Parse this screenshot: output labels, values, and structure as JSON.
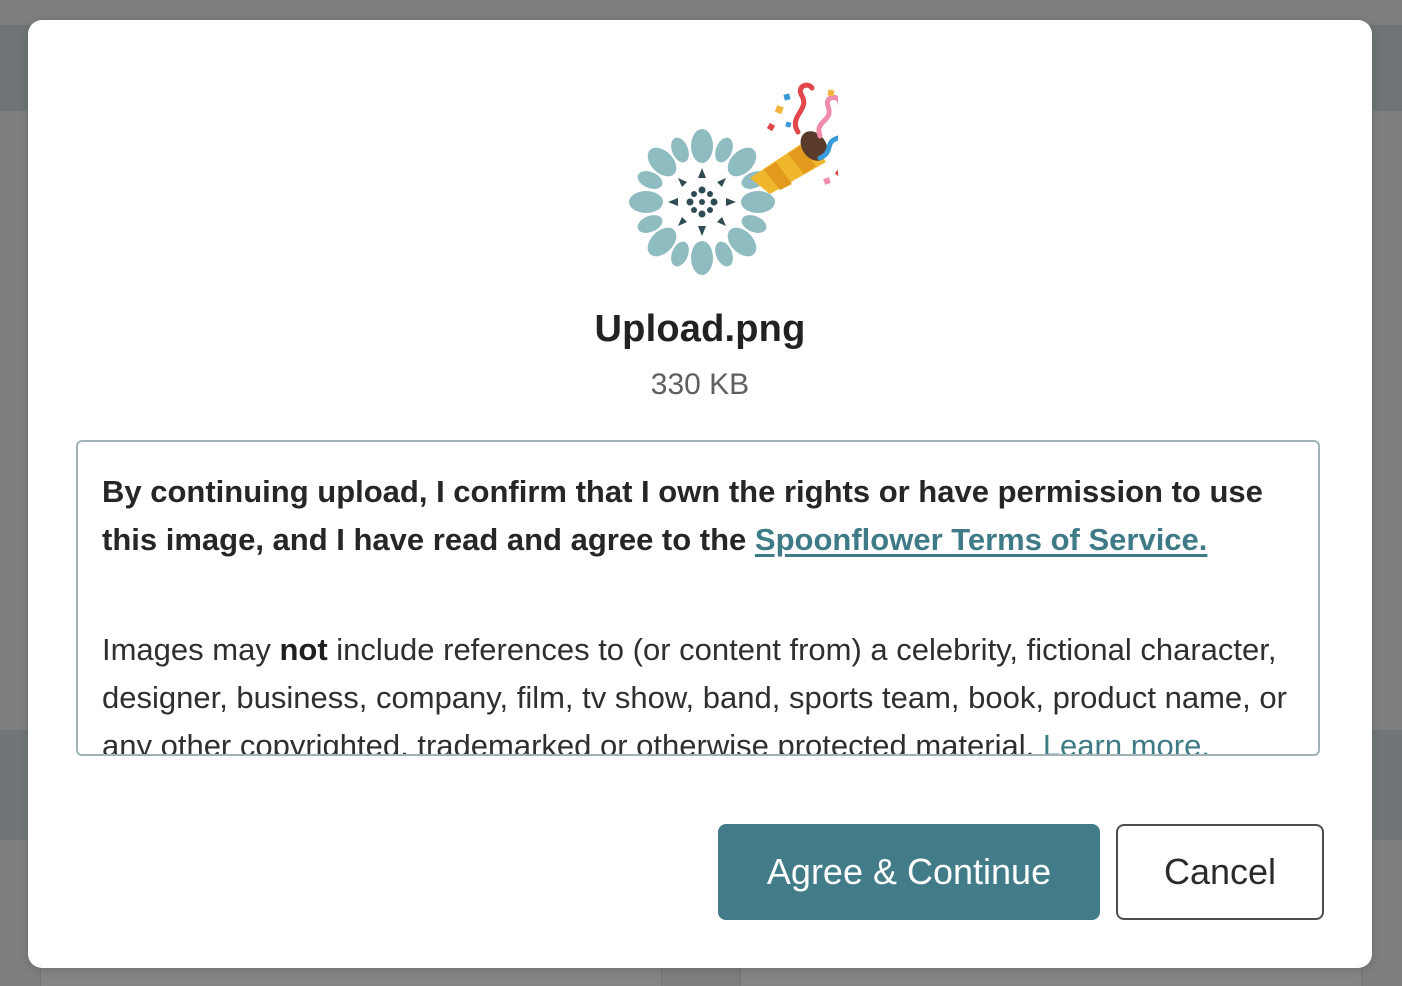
{
  "file": {
    "name": "Upload.png",
    "size": "330 KB"
  },
  "terms": {
    "p1_text": "By continuing upload, I confirm that I own the rights or have permission to use this image, and I have read and agree to the ",
    "p1_link": "Spoonflower Terms of Service.",
    "p2_before": "Images may ",
    "p2_bold": "not",
    "p2_after": " include references to (or content from) a celebrity, fictional character, designer, business, company, film, tv show, band, sports team, book, product name, or any other copyrighted, trademarked or otherwise protected material. ",
    "p2_link": "Learn more."
  },
  "buttons": {
    "agree_label": "Agree & Continue",
    "cancel_label": "Cancel"
  },
  "colors": {
    "accent": "#427c88",
    "link": "#3f7b87",
    "box_border": "#9fb3b6",
    "pattern_teal": "#8fbcc0",
    "pattern_dark": "#2f4b53"
  },
  "icons": {
    "illustration": "party-popper-with-floral-pattern-icon"
  }
}
